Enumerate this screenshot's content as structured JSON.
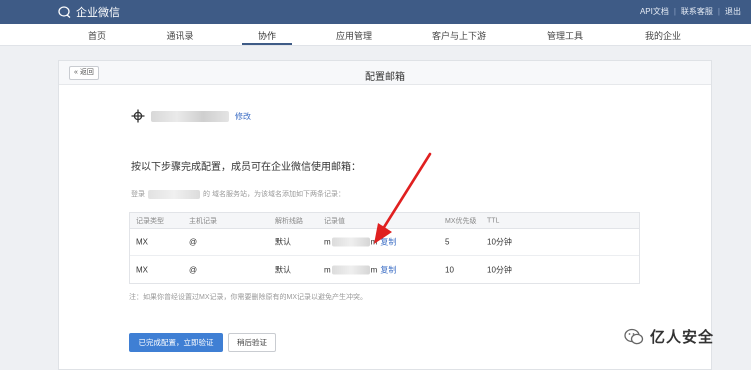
{
  "header": {
    "logo_text": "企业微信",
    "links": [
      "API文档",
      "联系客服",
      "退出"
    ]
  },
  "nav": {
    "items": [
      "首页",
      "通讯录",
      "协作",
      "应用管理",
      "客户与上下游",
      "管理工具",
      "我的企业"
    ],
    "active_index": 2
  },
  "panel": {
    "back_label": "« 返回",
    "title": "配置邮箱",
    "edit_label": "修改",
    "instruction": "按以下步骤完成配置，成员可在企业微信使用邮箱：",
    "domain_prefix": "登录",
    "domain_suffix": "的 域名服务站，为该域名添加如下两条记录：",
    "table": {
      "headers": [
        "记录类型",
        "主机记录",
        "解析线路",
        "记录值",
        "MX优先级",
        "TTL"
      ],
      "rows": [
        {
          "type": "MX",
          "host": "@",
          "line": "默认",
          "val_start": "m",
          "val_end": "m",
          "copy": "复制",
          "priority": "5",
          "ttl": "10分钟"
        },
        {
          "type": "MX",
          "host": "@",
          "line": "默认",
          "val_start": "m",
          "val_end": "m",
          "copy": "复制",
          "priority": "10",
          "ttl": "10分钟"
        }
      ]
    },
    "note": "注：如果你曾经设置过MX记录，你需要删除原有的MX记录以避免产生冲突。",
    "primary_button": "已完成配置，立即验证",
    "secondary_button": "稍后验证"
  },
  "watermark": {
    "text": "亿人安全"
  },
  "colors": {
    "topbar": "#3e5b86",
    "link": "#3a6cc4",
    "primary": "#3f7fd4",
    "arrow": "#e02020"
  }
}
